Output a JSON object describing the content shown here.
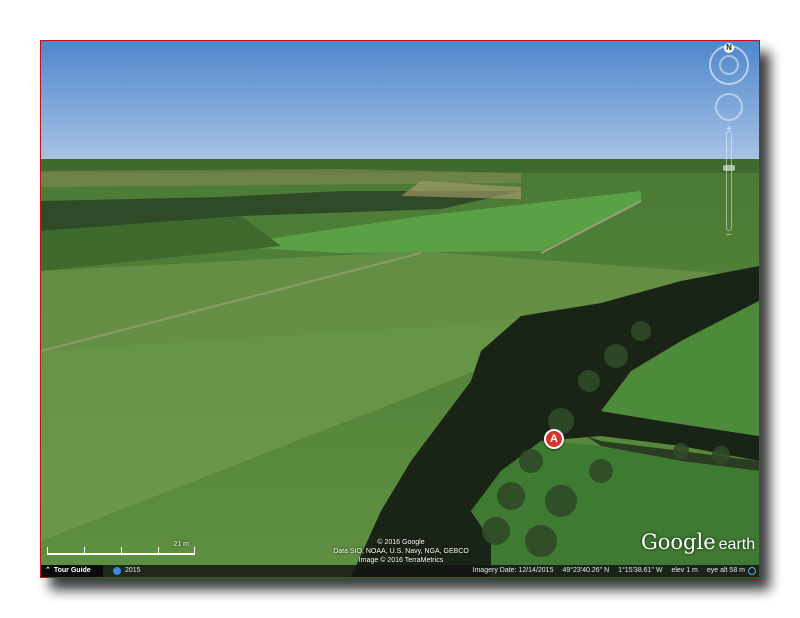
{
  "marker": {
    "label": "A"
  },
  "attribution": {
    "copyright": "© 2016 Google",
    "data_sources": "Data SIO, NOAA, U.S. Navy, NGA, GEBCO",
    "image_credit": "Image © 2016 TerraMetrics"
  },
  "logo": {
    "brand": "Google",
    "product": "earth"
  },
  "scale_bar": {
    "label": "21 m"
  },
  "status_bar": {
    "tour_guide": "Tour Guide",
    "year": "2015",
    "imagery_date": "Imagery Date: 12/14/2015",
    "latitude": "49°23'40.26\" N",
    "longitude": "1°15'38.61\" W",
    "elevation": "elev   1 m",
    "eye_altitude": "eye alt   58 m"
  },
  "navigation": {
    "north_label": "N",
    "zoom_in": "+",
    "zoom_out": "−"
  },
  "colors": {
    "sky_top": "#5b8ecf",
    "sky_horizon": "#a4c1e4",
    "field": "#5a8a3c",
    "forest": "#1a2416",
    "frame_border": "#c0141a",
    "marker": "#d6352c"
  }
}
